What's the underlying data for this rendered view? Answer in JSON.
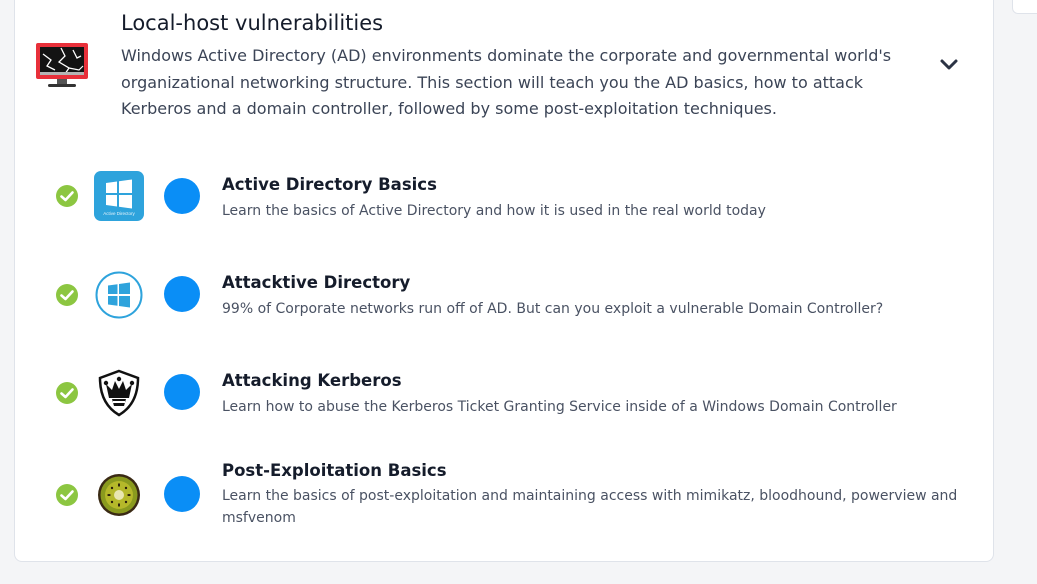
{
  "module": {
    "title": "Local-host vulnerabilities",
    "description": "Windows Active Directory (AD) environments dominate the corporate and governmental world's organizational networking structure. This section will teach you the AD basics, how to attack Kerberos and a domain controller, followed by some post-exploitation techniques.",
    "icon": "broken-monitor-icon",
    "expand_icon": "chevron-down-icon"
  },
  "rooms": [
    {
      "title": "Active Directory Basics",
      "description": "Learn the basics of Active Directory and how it is used in the real world today",
      "icon": "windows-logo-icon",
      "icon_caption": "Active Directory",
      "status": "completed"
    },
    {
      "title": "Attacktive Directory",
      "description": "99% of Corporate networks run off of AD. But can you exploit a vulnerable Domain Controller?",
      "icon": "windows-circle-icon",
      "status": "completed"
    },
    {
      "title": "Attacking Kerberos",
      "description": "Learn how to abuse the Kerberos Ticket Granting Service inside of a Windows Domain Controller",
      "icon": "jester-shield-icon",
      "status": "completed"
    },
    {
      "title": "Post-Exploitation Basics",
      "description": "Learn the basics of post-exploitation and maintaining access with mimikatz, bloodhound, powerview and msfvenom",
      "icon": "kiwi-icon",
      "status": "completed"
    }
  ],
  "colors": {
    "check": "#8cc641",
    "dot": "#0a8ef6",
    "windows_tile": "#2ea3dc"
  }
}
